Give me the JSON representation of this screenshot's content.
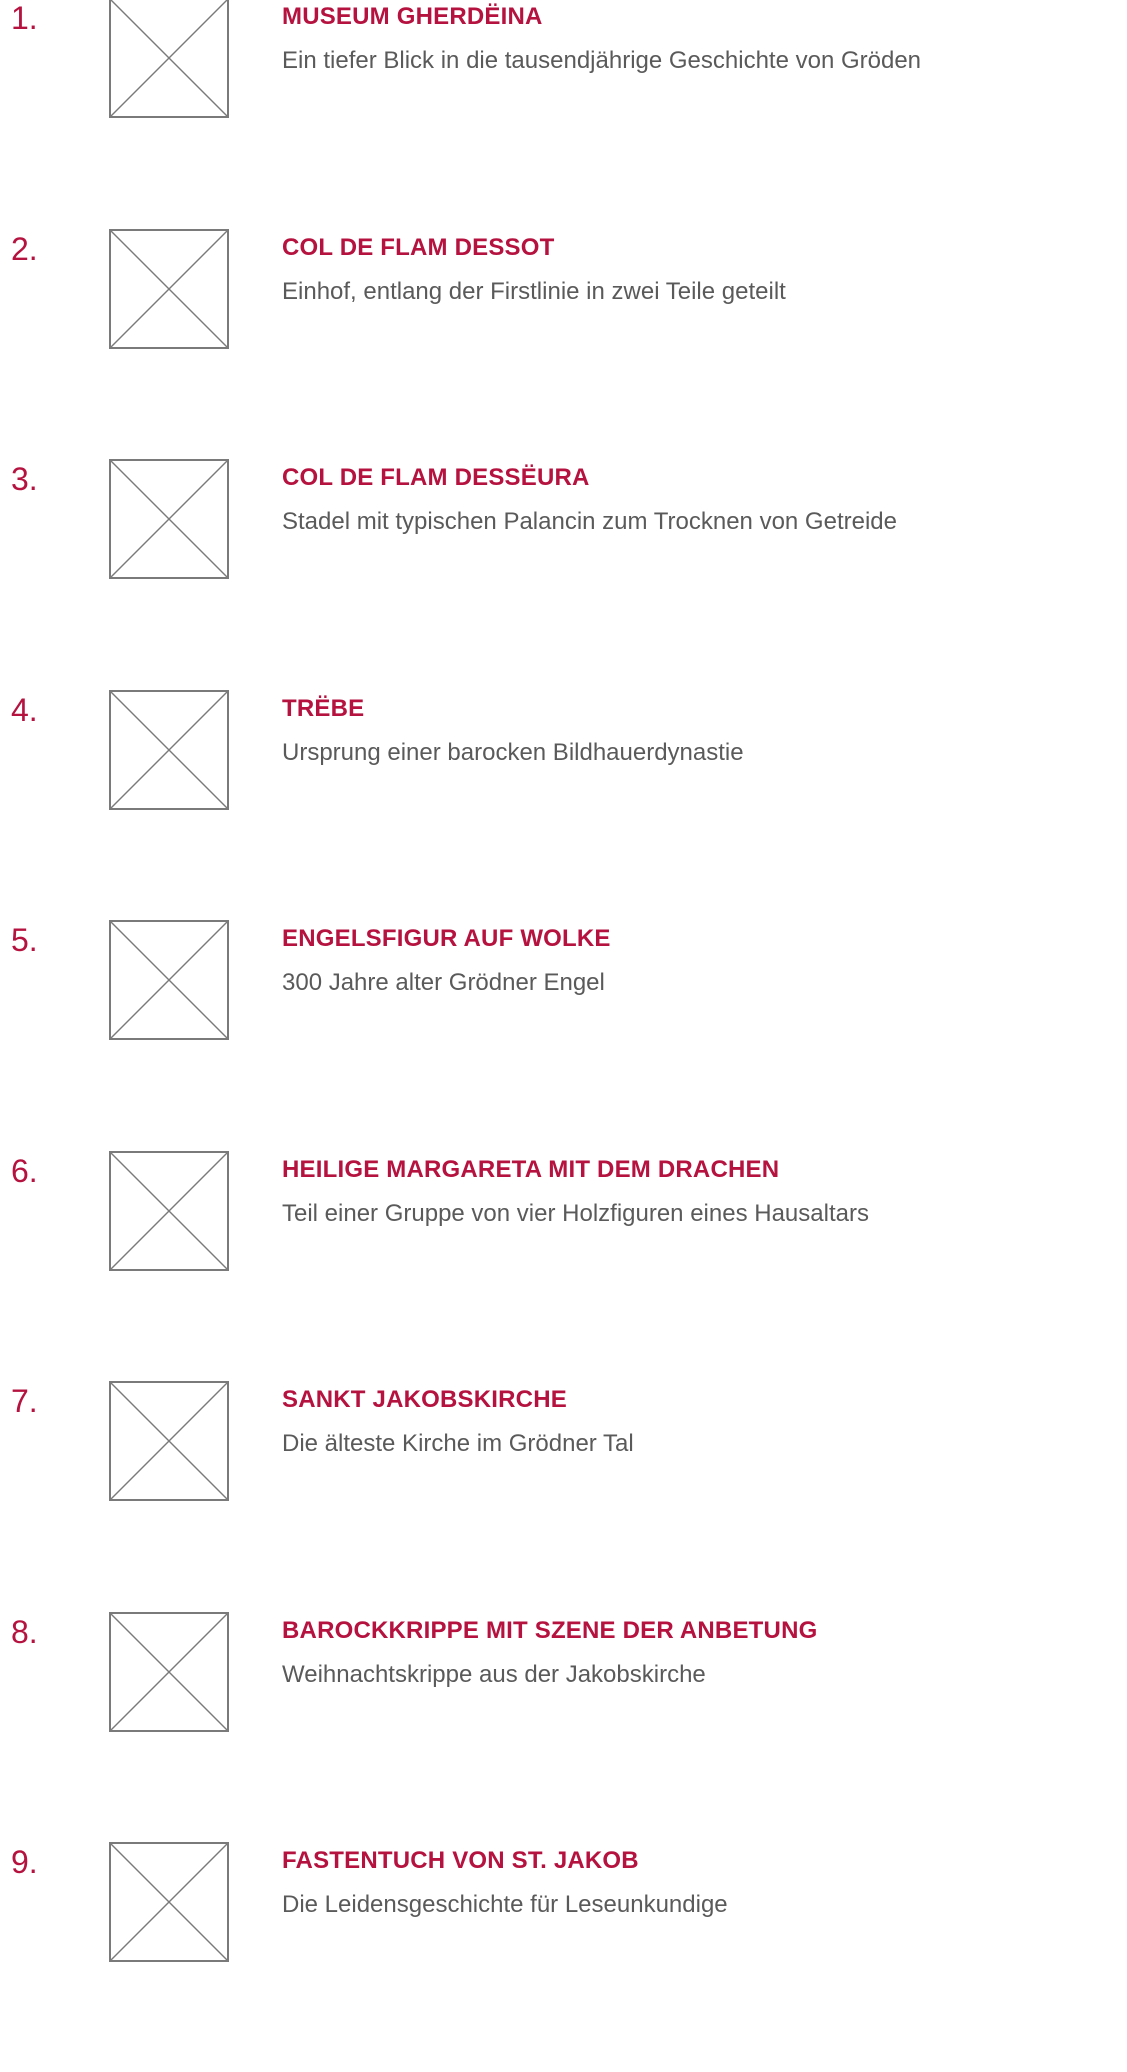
{
  "colors": {
    "accent": "#b5123f",
    "text": "#5a5a5a",
    "placeholder_stroke": "#7a7a7a",
    "background": "#ffffff"
  },
  "items": [
    {
      "number": "1.",
      "title": "MUSEUM GHERDËINA",
      "subtitle": "Ein tiefer Blick in die tausendjährige Geschichte von Gröden",
      "icon": "image-placeholder-icon"
    },
    {
      "number": "2.",
      "title": "COL DE FLAM DESSOT",
      "subtitle": "Einhof, entlang der Firstlinie in zwei Teile geteilt",
      "icon": "image-placeholder-icon"
    },
    {
      "number": "3.",
      "title": "COL DE FLAM DESSËURA",
      "subtitle": "Stadel mit typischen Palancin zum Trocknen von Getreide",
      "icon": "image-placeholder-icon"
    },
    {
      "number": "4.",
      "title": "TRËBE",
      "subtitle": "Ursprung einer barocken Bildhauerdynastie",
      "icon": "image-placeholder-icon"
    },
    {
      "number": "5.",
      "title": "ENGELSFIGUR AUF WOLKE",
      "subtitle": "300 Jahre alter Grödner Engel",
      "icon": "image-placeholder-icon"
    },
    {
      "number": "6.",
      "title": "HEILIGE MARGARETA MIT DEM DRACHEN",
      "subtitle": "Teil einer Gruppe von vier Holzfiguren eines Hausaltars",
      "icon": "image-placeholder-icon"
    },
    {
      "number": "7.",
      "title": "SANKT JAKOBSKIRCHE",
      "subtitle": "Die älteste Kirche im Grödner Tal",
      "icon": "image-placeholder-icon"
    },
    {
      "number": "8.",
      "title": "BAROCKKRIPPE MIT SZENE DER ANBETUNG",
      "subtitle": "Weihnachtskrippe aus der Jakobskirche",
      "icon": "image-placeholder-icon"
    },
    {
      "number": "9.",
      "title": "FASTENTUCH VON ST. JAKOB",
      "subtitle": "Die Leidensgeschichte für Leseunkundige",
      "icon": "image-placeholder-icon"
    }
  ]
}
